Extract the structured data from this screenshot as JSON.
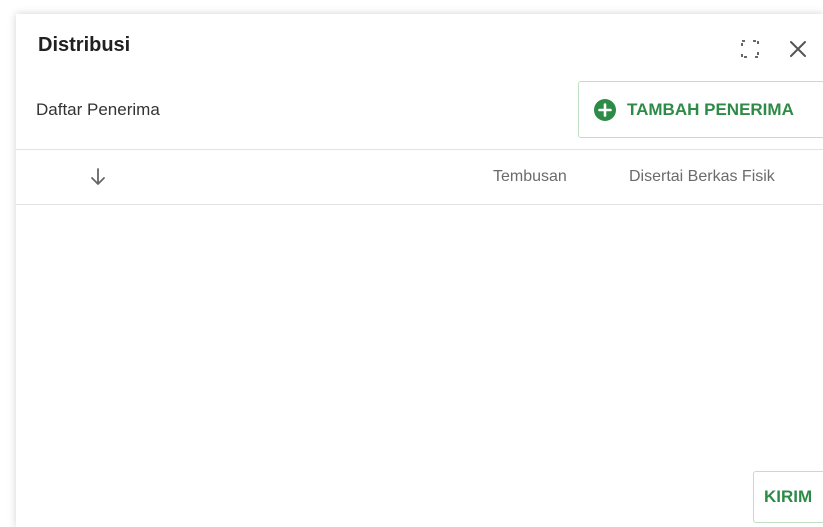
{
  "dialog": {
    "title": "Distribusi",
    "expand_icon": "fullscreen-icon",
    "close_icon": "close-icon"
  },
  "recipients": {
    "list_label": "Daftar Penerima",
    "add_button_label": "TAMBAH PENERIMA",
    "add_button_icon": "plus-circle-icon"
  },
  "table": {
    "sort_icon": "arrow-down-icon",
    "columns": [
      "Tembusan",
      "Disertai Berkas Fisik"
    ],
    "rows": []
  },
  "footer": {
    "send_button_label": "KIRIM"
  },
  "colors": {
    "accent": "#2e8b47",
    "button_border": "#bfe0c3",
    "divider": "#e3e3e3"
  }
}
